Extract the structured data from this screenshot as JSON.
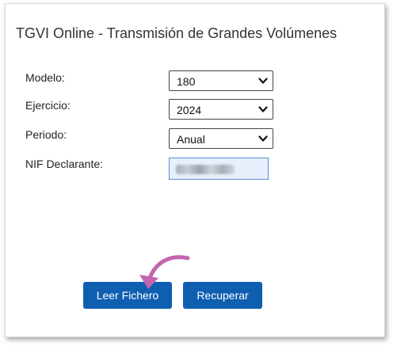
{
  "title": "TGVI Online - Transmisión de Grandes Volúmenes",
  "form": {
    "modelo": {
      "label": "Modelo:",
      "value": "180"
    },
    "ejercicio": {
      "label": "Ejercicio:",
      "value": "2024"
    },
    "periodo": {
      "label": "Periodo:",
      "value": "Anual"
    },
    "nif": {
      "label": "NIF Declarante:"
    }
  },
  "buttons": {
    "leer": "Leer Fichero",
    "recuperar": "Recuperar"
  },
  "colors": {
    "button_bg": "#0f5fb1",
    "input_autofill_bg": "#e8f0fe",
    "arrow": "#c266b0"
  },
  "icons": {
    "select_caret": "chevron-down-icon",
    "annotation": "curved-arrow-icon"
  }
}
